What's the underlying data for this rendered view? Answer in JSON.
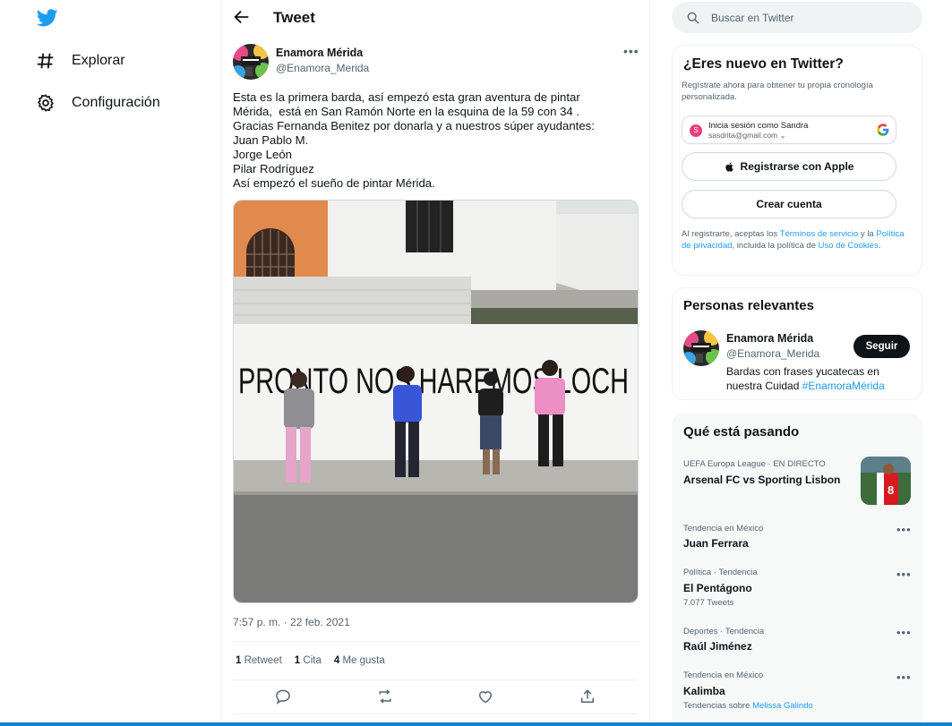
{
  "nav": {
    "explore_label": "Explorar",
    "settings_label": "Configuración"
  },
  "header": {
    "title": "Tweet"
  },
  "tweet": {
    "author_name": "Enamora Mérida",
    "author_handle": "@Enamora_Merida",
    "text_lines": [
      "Esta es la primera barda, así empezó esta gran aventura de pintar",
      "Mérida,  está en San Ramón Norte en la esquina de la 59 con 34 .",
      "Gracias Fernanda Benitez por donarla y a nuestros súper ayudantes:",
      "Juan Pablo M.",
      "Jorge León",
      "Pilar Rodríguez",
      "Así empezó el sueño de pintar Mérida."
    ],
    "mural_text": "PRONTO NOS HAREMOS LOCH",
    "timestamp": "7:57 p. m. · 22 feb. 2021",
    "retweets_count": "1",
    "retweets_label": "Retweet",
    "quotes_count": "1",
    "quotes_label": "Cita",
    "likes_count": "4",
    "likes_label": "Me gusta"
  },
  "search": {
    "placeholder": "Buscar en Twitter"
  },
  "new_panel": {
    "title": "¿Eres nuevo en Twitter?",
    "subtitle": "Regístrate ahora para obtener tu propia cronología personalizada.",
    "google_avatar_letter": "S",
    "google_line1": "Inicia sesión como Sandra",
    "google_line2": "sasdrita@gmail.com",
    "apple_label": "Registrarse con Apple",
    "create_label": "Crear cuenta",
    "terms_1": "Al registrarte, aceptas los ",
    "terms_link1": "Términos de servicio",
    "terms_2": " y la ",
    "terms_link2": "Política de privacidad",
    "terms_3": ", incluida la política de ",
    "terms_link3": "Uso de Cookies",
    "terms_4": "."
  },
  "people": {
    "title": "Personas relevantes",
    "name": "Enamora Mérida",
    "handle": "@Enamora_Merida",
    "follow_label": "Seguir",
    "bio": "Bardas con frases yucatecas en nuestra Cuidad ",
    "bio_hashtag": "#EnamoraMérida"
  },
  "trends": {
    "title": "Qué está pasando",
    "items": [
      {
        "meta": "UEFA Europa League · EN DIRECTO",
        "name": "Arsenal FC vs Sporting Lisbon"
      },
      {
        "meta": "Tendencia en México",
        "name": "Juan Ferrara"
      },
      {
        "meta": "Política · Tendencia",
        "name": "El Pentágono",
        "sub": "7.077 Tweets"
      },
      {
        "meta": "Deportes · Tendencia",
        "name": "Raúl Jiménez"
      },
      {
        "meta": "Tendencia en México",
        "name": "Kalimba",
        "sub": "Tendencias sobre ",
        "sub_link": "Melissa Galindo"
      }
    ]
  },
  "colors": {
    "accent": "#1d9bf0",
    "text": "#0f1419",
    "muted": "#536471"
  }
}
